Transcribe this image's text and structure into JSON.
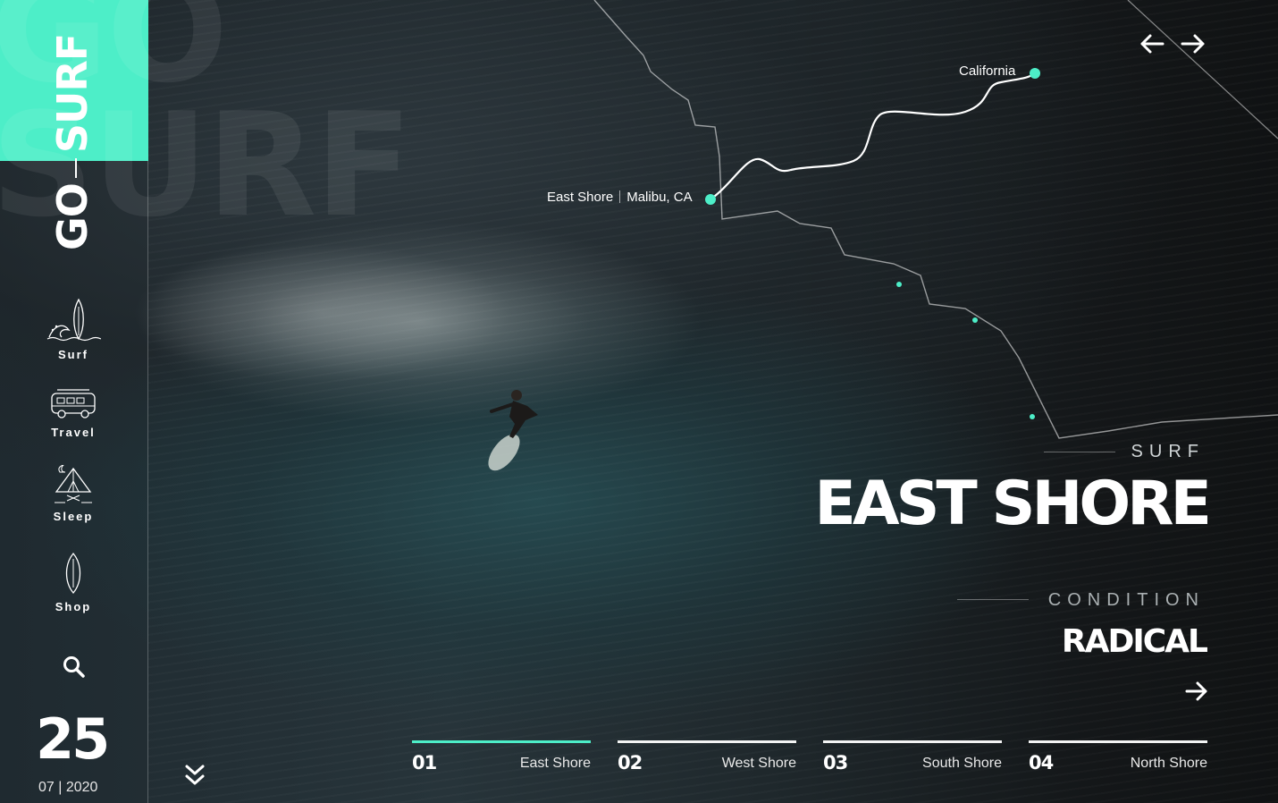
{
  "brand": {
    "word1": "GO",
    "word2": "SURF",
    "watermark": "GO\nSURF",
    "accent": "#4deec8"
  },
  "sidebar": {
    "items": [
      {
        "label": "Surf",
        "icon": "surfboard-wave-icon"
      },
      {
        "label": "Travel",
        "icon": "van-icon"
      },
      {
        "label": "Sleep",
        "icon": "tent-campfire-icon"
      },
      {
        "label": "Shop",
        "icon": "surfboard-icon"
      }
    ],
    "search_icon": "search-icon"
  },
  "date": {
    "day": "25",
    "month": "07",
    "year": "2020",
    "separator": "|"
  },
  "map": {
    "region_label": "California",
    "location_name": "East Shore",
    "location_place": "Malibu, CA"
  },
  "hero": {
    "eyebrow": "SURF",
    "title": "EAST SHORE",
    "condition_label": "CONDITION",
    "condition_value": "RADICAL"
  },
  "tabs": [
    {
      "num": "01",
      "name": "East Shore",
      "active": true
    },
    {
      "num": "02",
      "name": "West Shore",
      "active": false
    },
    {
      "num": "03",
      "name": "South Shore",
      "active": false
    },
    {
      "num": "04",
      "name": "North Shore",
      "active": false
    }
  ]
}
